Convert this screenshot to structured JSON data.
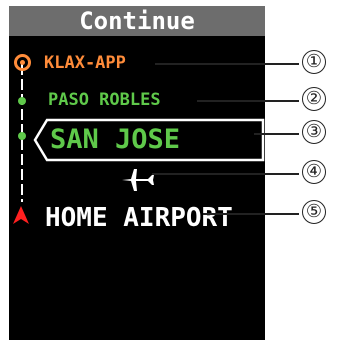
{
  "header": {
    "title": "Continue"
  },
  "route": {
    "waypoints": [
      {
        "label": "KLAX-APP"
      },
      {
        "label": "PASO ROBLES"
      },
      {
        "label": "SAN JOSE"
      },
      {
        "label": "HOME AIRPORT"
      }
    ]
  },
  "callouts": [
    "①",
    "②",
    "③",
    "④",
    "⑤"
  ],
  "colors": {
    "active": "#ff8c3a",
    "future": "#5fc94a",
    "destination": "#ff2020"
  }
}
